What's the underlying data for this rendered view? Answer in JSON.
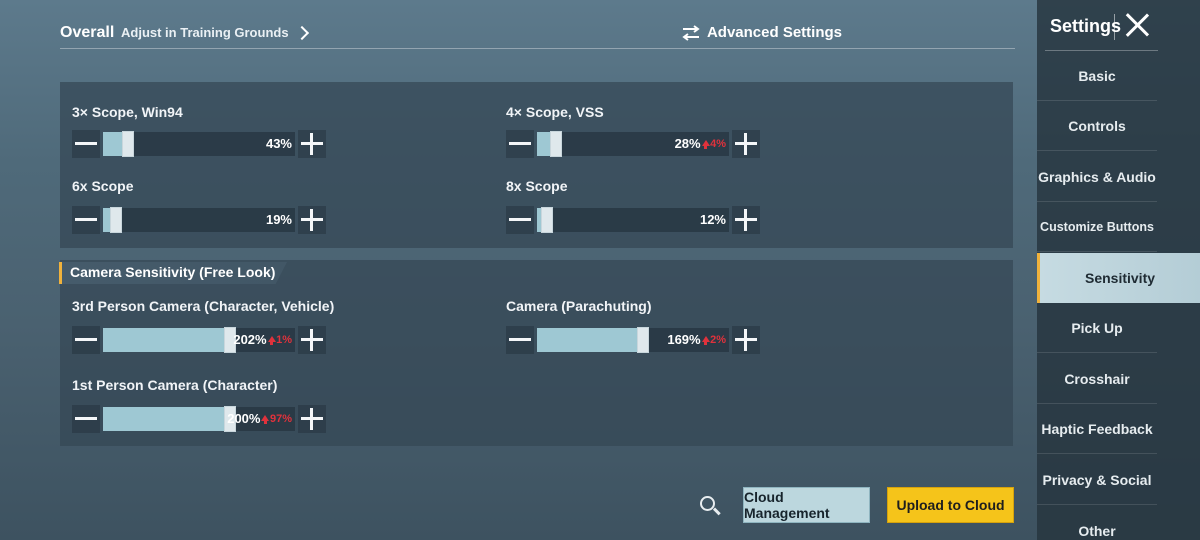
{
  "header": {
    "tab_overall": "Overall",
    "tab_adjust": "Adjust in Training Grounds",
    "advanced_settings": "Advanced Settings"
  },
  "scope": {
    "s3x": {
      "label": "3× Scope, Win94",
      "value": "43%",
      "delta": "",
      "level": 0.13
    },
    "s4x": {
      "label": "4× Scope, VSS",
      "value": "28%",
      "delta": "4%",
      "level": 0.1
    },
    "s6x": {
      "label": "6x Scope",
      "value": "19%",
      "delta": "",
      "level": 0.07
    },
    "s8x": {
      "label": "8x Scope",
      "value": "12%",
      "delta": "",
      "level": 0.05
    }
  },
  "camera": {
    "section_title": "Camera Sensitivity (Free Look)",
    "third": {
      "label": "3rd Person Camera (Character, Vehicle)",
      "value": "202%",
      "delta": "1%",
      "level": 0.66
    },
    "para": {
      "label": "Camera (Parachuting)",
      "value": "169%",
      "delta": "2%",
      "level": 0.55
    },
    "first": {
      "label": "1st Person Camera (Character)",
      "value": "200%",
      "delta": "97%",
      "level": 0.66
    }
  },
  "sidebar": {
    "title": "Settings",
    "items": [
      "Basic",
      "Controls",
      "Graphics & Audio",
      "Customize Buttons",
      "Sensitivity",
      "Pick Up",
      "Crosshair",
      "Haptic Feedback",
      "Privacy & Social",
      "Other"
    ],
    "active": "Sensitivity"
  },
  "footer": {
    "cloud_management": "Cloud Management",
    "upload_to_cloud": "Upload to Cloud"
  },
  "icons": {
    "adjust_chevron": "chevron-right-icon",
    "advanced": "swap-arrows-icon",
    "close": "close-icon",
    "search": "search-icon",
    "delta_arrow": "up-arrow-icon"
  },
  "colors": {
    "accent": "#f0b23c",
    "slider_fill": "#9ec8d3",
    "delta": "#e0323c",
    "upload": "#f5c41a"
  }
}
